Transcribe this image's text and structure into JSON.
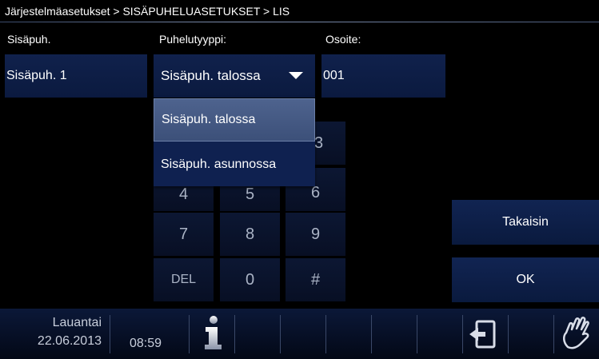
{
  "breadcrumb": "Järjestelmäasetukset > SISÄPUHELUASETUKSET > LIS",
  "labels": {
    "extension": "Sisäpuh.",
    "call_type": "Puhelutyyppi:",
    "address": "Osoite:"
  },
  "fields": {
    "extension_value": "Sisäpuh. 1",
    "call_type_value": "Sisäpuh. talossa",
    "address_value": "001"
  },
  "dropdown": {
    "options": [
      "Sisäpuh. talossa",
      "Sisäpuh. asunnossa"
    ],
    "selected_index": 0
  },
  "keypad": {
    "k3": "3",
    "k4": "4",
    "k5": "5",
    "k6": "6",
    "k7": "7",
    "k8": "8",
    "k9": "9",
    "del": "DEL",
    "k0": "0",
    "hash": "#"
  },
  "buttons": {
    "back": "Takaisin",
    "ok": "OK"
  },
  "footer": {
    "day": "Lauantai",
    "date": "22.06.2013",
    "time": "08:59"
  },
  "colors": {
    "field_bg": "#10214c",
    "selected_option": "#4e638e",
    "footer_bg": "#0b1838"
  }
}
